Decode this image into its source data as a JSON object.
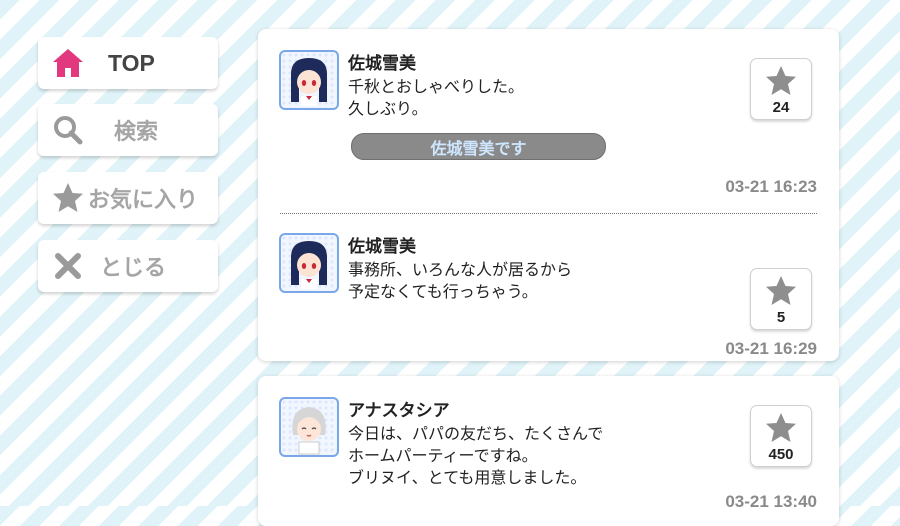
{
  "nav": [
    {
      "label": "TOP",
      "icon": "home-icon"
    },
    {
      "label": "検索",
      "icon": "search-icon"
    },
    {
      "label": "お気に入り",
      "icon": "star-icon"
    },
    {
      "label": "とじる",
      "icon": "close-icon"
    }
  ],
  "posts": [
    {
      "name": "佐城雪美",
      "message": "千秋とおしゃべりした。\n久しぶり。",
      "likes": "24",
      "time": "03-21 16:23",
      "reply": "佐城雪美です"
    },
    {
      "name": "佐城雪美",
      "message": "事務所、いろんな人が居るから\n予定なくても行っちゃう。",
      "likes": "5",
      "time": "03-21 16:29"
    },
    {
      "name": "アナスタシア",
      "message": "今日は、パパの友だち、たくさんで\nホームパーティーですね。\nブリヌイ、とても用意しました。",
      "likes": "450",
      "time": "03-21 13:40"
    }
  ],
  "colors": {
    "accent_pink": "#e2387e",
    "icon_gray": "#9a9a9a",
    "star_gray": "#8e8e8e"
  }
}
